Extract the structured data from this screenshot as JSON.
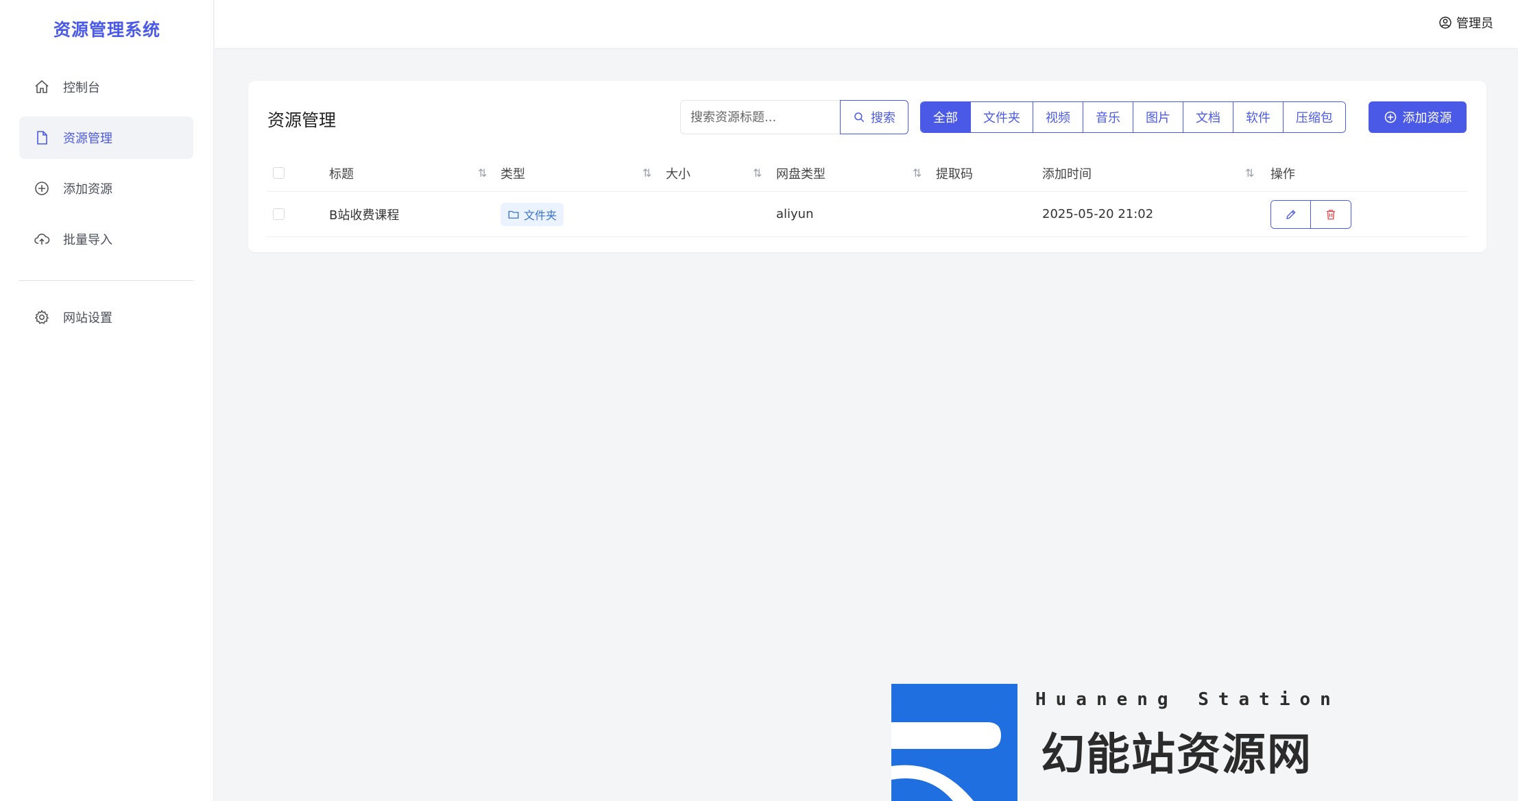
{
  "brand": "资源管理系统",
  "sidebar": {
    "items": [
      {
        "label": "控制台"
      },
      {
        "label": "资源管理"
      },
      {
        "label": "添加资源"
      },
      {
        "label": "批量导入"
      },
      {
        "label": "网站设置"
      }
    ]
  },
  "topbar": {
    "user": "管理员"
  },
  "page": {
    "title": "资源管理",
    "search": {
      "placeholder": "搜索资源标题...",
      "button": "搜索"
    },
    "filters": [
      "全部",
      "文件夹",
      "视频",
      "音乐",
      "图片",
      "文档",
      "软件",
      "压缩包"
    ],
    "add_button": "添加资源"
  },
  "table": {
    "columns": [
      "标题",
      "类型",
      "大小",
      "网盘类型",
      "提取码",
      "添加时间",
      "操作"
    ],
    "rows": [
      {
        "title": "B站收费课程",
        "type": "文件夹",
        "size": "",
        "disk": "aliyun",
        "code": "",
        "added": "2025-05-20 21:02"
      }
    ]
  },
  "colors": {
    "accent": "#4b5ae6",
    "tag_bg": "#eaf3ff",
    "danger": "#e0454b"
  },
  "watermark": {
    "caption": "Huaneng Station",
    "name": "幻能站资源网"
  }
}
